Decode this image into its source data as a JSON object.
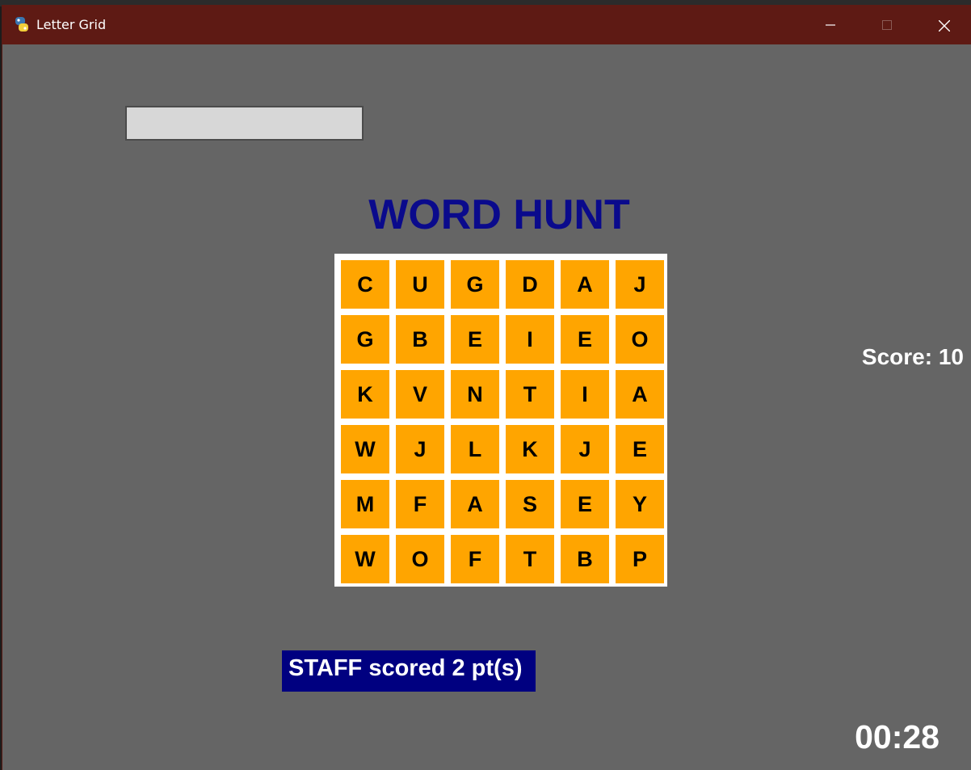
{
  "window": {
    "title": "Letter Grid",
    "app_icon": "python-snake-icon",
    "controls": [
      "minimize-icon",
      "maximize-icon",
      "close-icon"
    ]
  },
  "name_input": {
    "value": "",
    "placeholder": ""
  },
  "game": {
    "title": "WORD HUNT",
    "grid": [
      [
        "C",
        "U",
        "G",
        "D",
        "A",
        "J"
      ],
      [
        "G",
        "B",
        "E",
        "I",
        "E",
        "O"
      ],
      [
        "K",
        "V",
        "N",
        "T",
        "I",
        "A"
      ],
      [
        "W",
        "J",
        "L",
        "K",
        "J",
        "E"
      ],
      [
        "M",
        "F",
        "A",
        "S",
        "E",
        "Y"
      ],
      [
        "W",
        "O",
        "F",
        "T",
        "B",
        "P"
      ]
    ],
    "score_text": "Score: 10",
    "status_message": "STAFF scored 2 pt(s)",
    "timer": "00:28"
  },
  "colors": {
    "background": "#656565",
    "titlebar": "#5e1a14",
    "tile": "#ffa500",
    "board_border": "#ffffff",
    "title_text": "#0a0a8c",
    "status_banner": "#000080",
    "input_box": "#d7d7d7"
  }
}
